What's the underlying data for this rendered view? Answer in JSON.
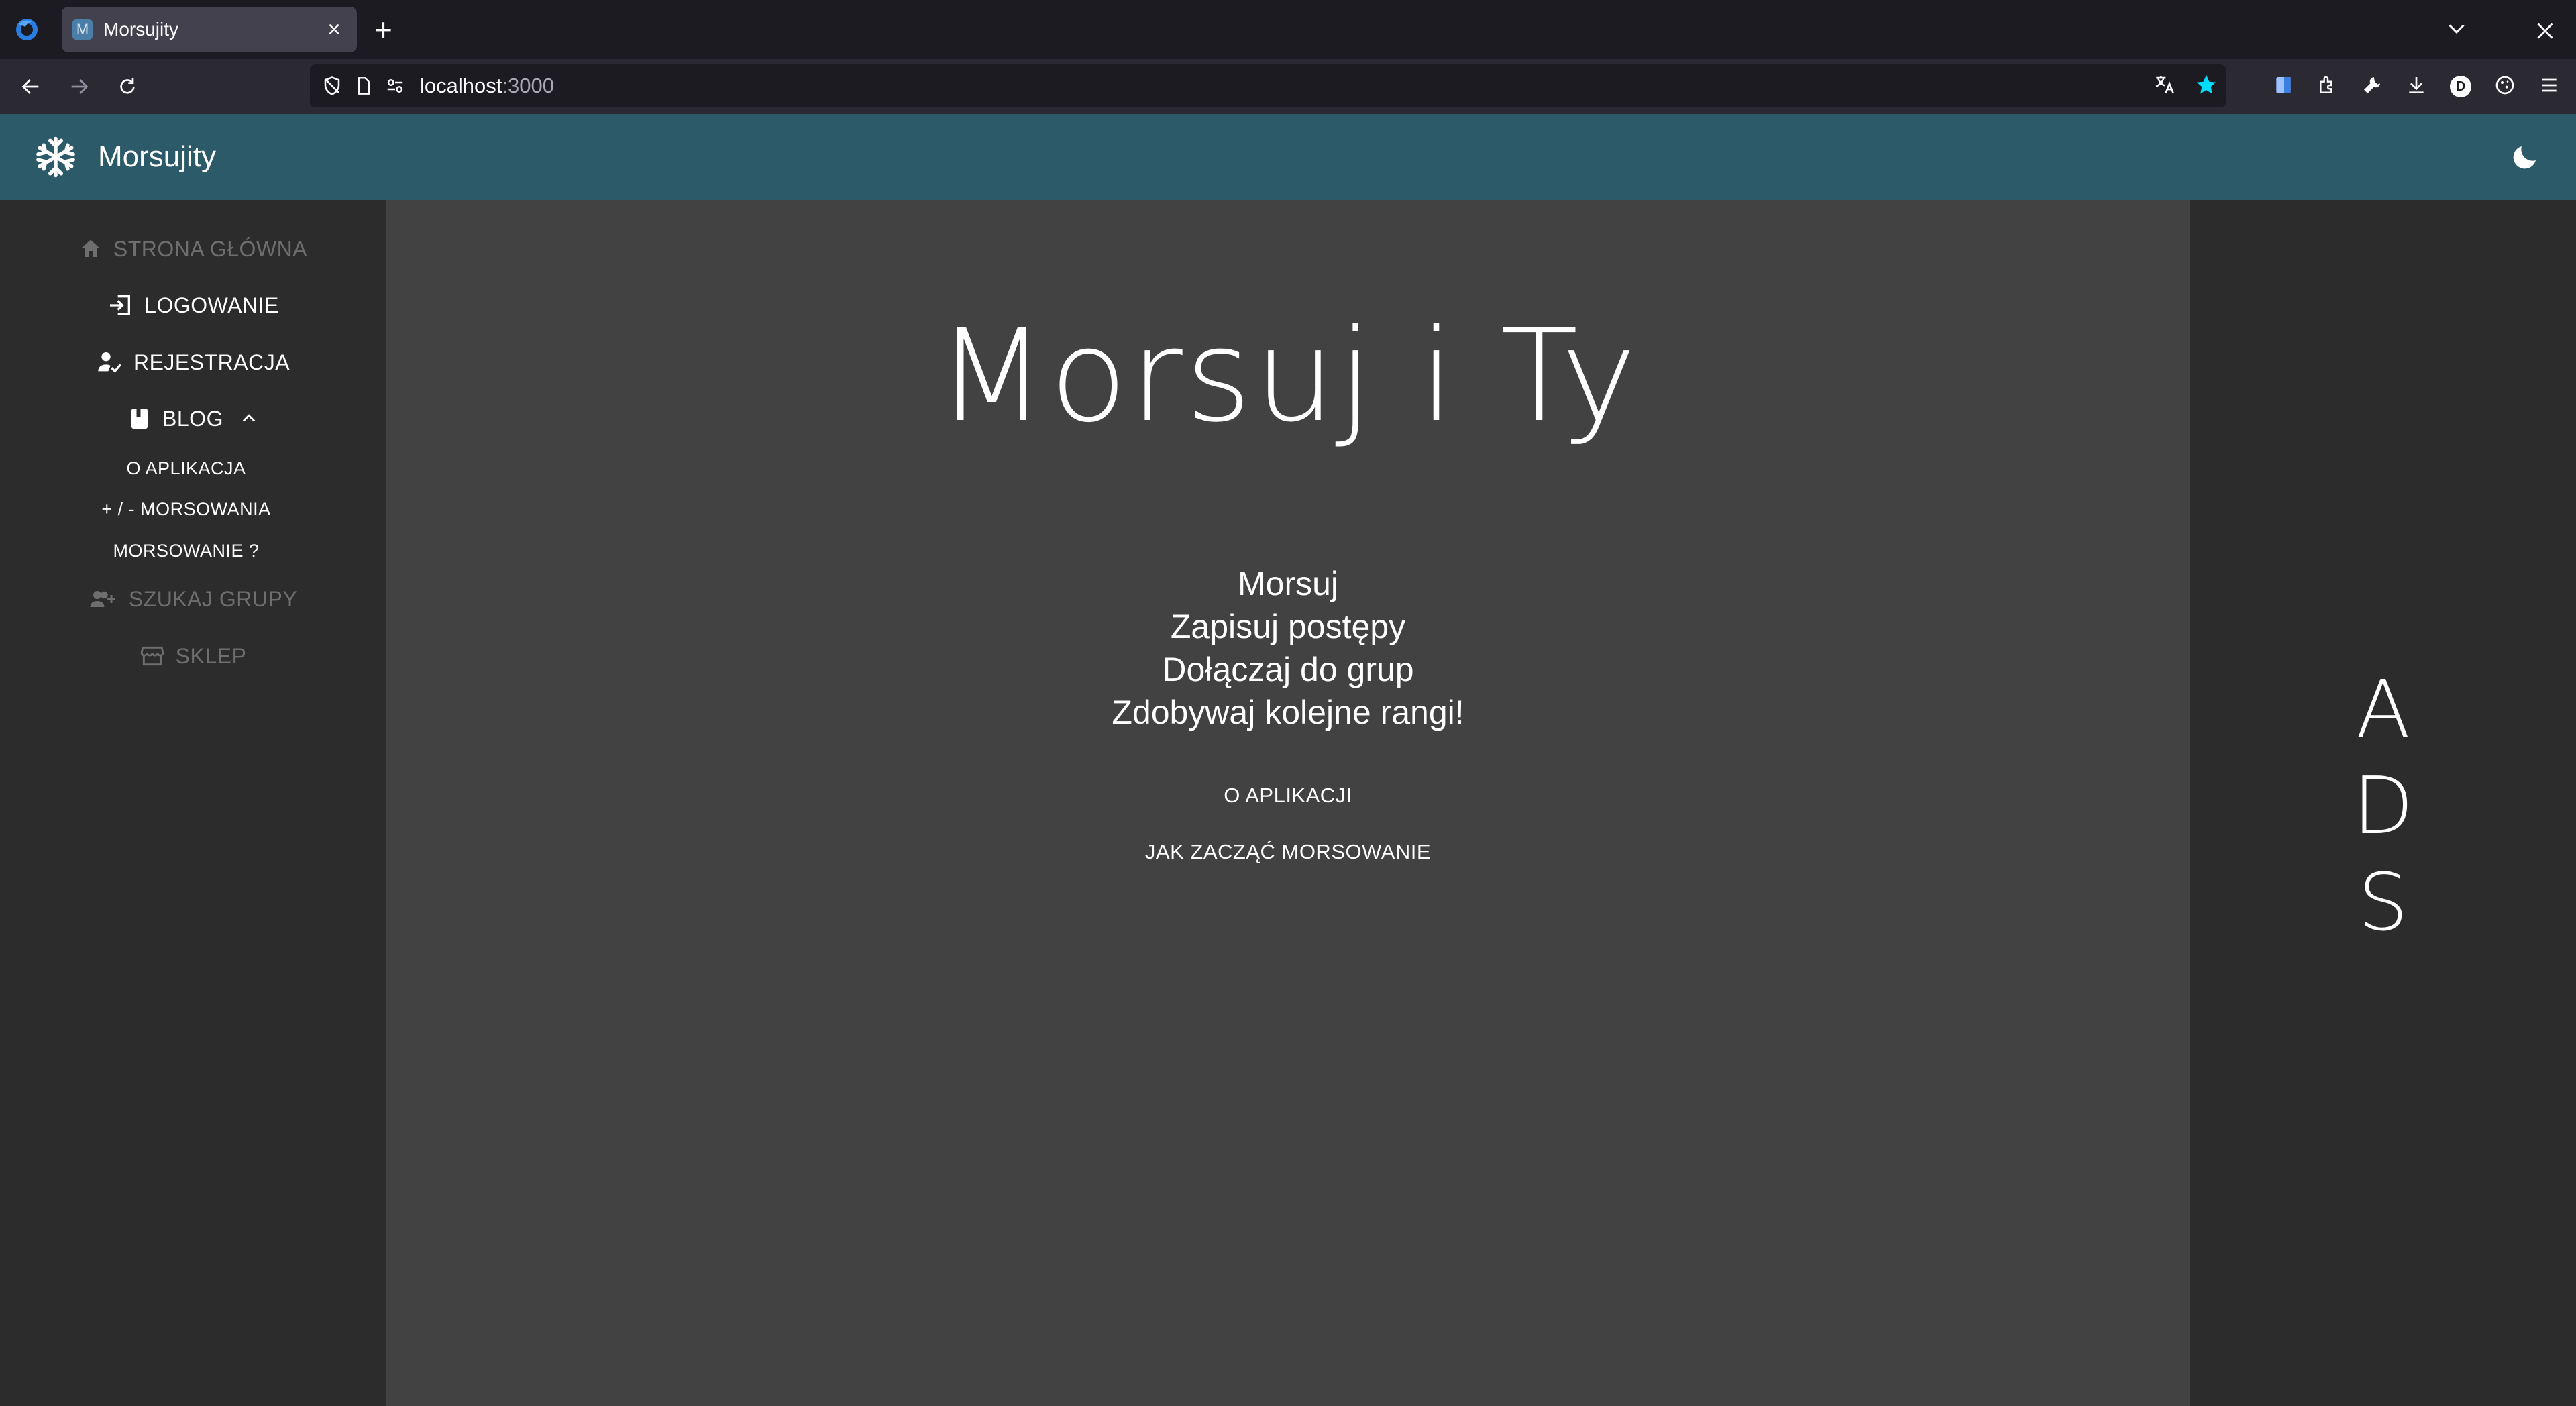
{
  "browser": {
    "tab_title": "Morsujity",
    "tab_favicon_letter": "M",
    "tab_close": "×",
    "new_tab": "+",
    "url_host": "localhost",
    "url_port": ":3000",
    "profile_letter": "D"
  },
  "app": {
    "title": "Morsujity"
  },
  "sidebar": {
    "items": [
      {
        "label": "STRONA GŁÓWNA",
        "icon": "home-icon",
        "disabled": true
      },
      {
        "label": "LOGOWANIE",
        "icon": "login-icon",
        "disabled": false
      },
      {
        "label": "REJESTRACJA",
        "icon": "register-icon",
        "disabled": false
      },
      {
        "label": "BLOG",
        "icon": "book-icon",
        "disabled": false
      },
      {
        "label": "SZUKAJ GRUPY",
        "icon": "group-add-icon",
        "disabled": true
      },
      {
        "label": "SKLEP",
        "icon": "store-icon",
        "disabled": true
      }
    ],
    "blog_sub": [
      {
        "label": "O APLIKACJA"
      },
      {
        "label": "+ / - MORSOWANIA"
      },
      {
        "label": "MORSOWANIE ?"
      }
    ]
  },
  "main": {
    "hero": "Morsuj i Ty",
    "tagline": [
      "Morsuj",
      "Zapisuj postępy",
      "Dołączaj do grup",
      "Zdobywaj kolejne rangi!"
    ],
    "buttons": [
      {
        "label": "O APLIKACJI"
      },
      {
        "label": "JAK ZACZĄĆ MORSOWANIE"
      }
    ]
  },
  "ads": {
    "letters": [
      "A",
      "D",
      "S"
    ]
  },
  "colors": {
    "appbar": "#2c5a68",
    "main_bg": "#424242",
    "side_bg": "#2c2c2c",
    "accent_star": "#00ddff"
  }
}
